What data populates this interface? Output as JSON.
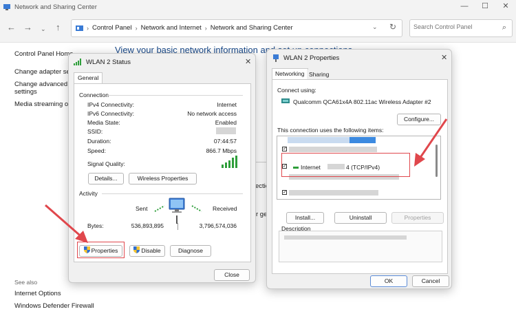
{
  "window": {
    "title": "Network and Sharing Center",
    "minimize": "—",
    "maximize": "☐",
    "close": "✕"
  },
  "address": {
    "crumbs": [
      "Control Panel",
      "Network and Internet",
      "Network and Sharing Center"
    ],
    "search_placeholder": "Search Control Panel"
  },
  "sidebar": {
    "home": "Control Panel Home",
    "items": [
      "Change adapter sett",
      "Change advanced s",
      "settings",
      "Media streaming op"
    ],
    "see_also": "See also",
    "links": [
      "Internet Options",
      "Windows Defender Firewall"
    ]
  },
  "main": {
    "heading": "View your basic network information and set up connections",
    "frag1": "ectio",
    "frag2": "r get"
  },
  "status_dialog": {
    "title": "WLAN 2 Status",
    "tab": "General",
    "connection_label": "Connection",
    "rows": [
      {
        "label": "IPv4 Connectivity:",
        "value": "Internet"
      },
      {
        "label": "IPv6 Connectivity:",
        "value": "No network access"
      },
      {
        "label": "Media State:",
        "value": "Enabled"
      },
      {
        "label": "SSID:",
        "value": ""
      },
      {
        "label": "Duration:",
        "value": "07:44:57"
      },
      {
        "label": "Speed:",
        "value": "866.7 Mbps"
      }
    ],
    "signal_label": "Signal Quality:",
    "details_btn": "Details...",
    "wireless_btn": "Wireless Properties",
    "activity_label": "Activity",
    "sent_label": "Sent",
    "received_label": "Received",
    "bytes_label": "Bytes:",
    "bytes_sent": "536,893,895",
    "bytes_received": "3,796,574,036",
    "properties_btn": "Properties",
    "disable_btn": "Disable",
    "diagnose_btn": "Diagnose",
    "close_btn": "Close"
  },
  "props_dialog": {
    "title": "WLAN 2 Properties",
    "tabs": [
      "Networking",
      "Sharing"
    ],
    "connect_using_label": "Connect using:",
    "adapter": "Qualcomm QCA61x4A 802.11ac Wireless Adapter #2",
    "configure_btn": "Configure...",
    "items_label": "This connection uses the following items:",
    "ipv4_item_a": "Internet",
    "ipv4_item_b": "4 (TCP/IPv4)",
    "install_btn": "Install...",
    "uninstall_btn": "Uninstall",
    "properties_btn": "Properties",
    "description_label": "Description",
    "ok_btn": "OK",
    "cancel_btn": "Cancel"
  },
  "colors": {
    "accent": "#1a4a8a",
    "annotation": "#e0474c",
    "signal": "#2e9e3a"
  }
}
